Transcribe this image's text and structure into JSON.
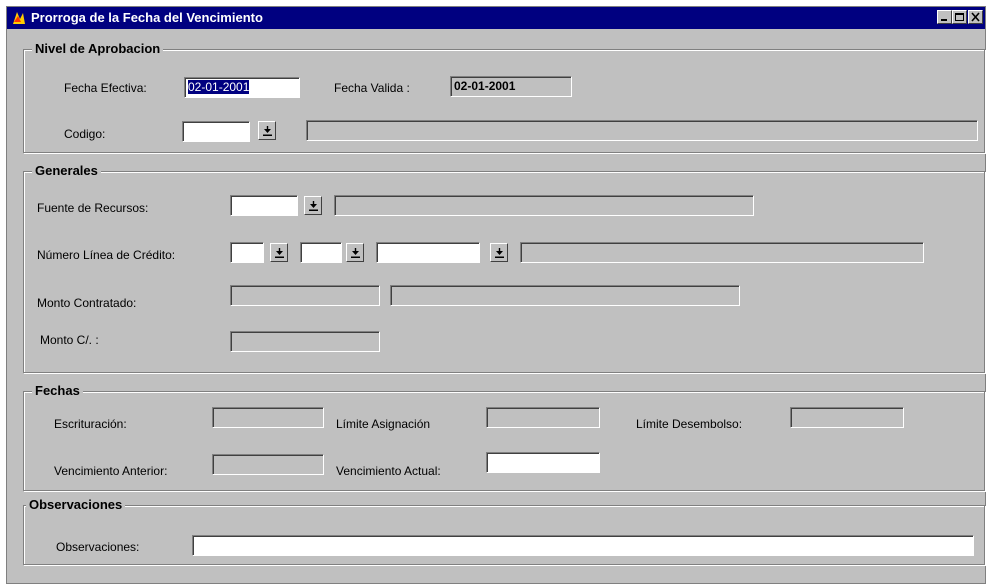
{
  "window": {
    "title": "Prorroga de la Fecha del Vencimiento"
  },
  "nivel": {
    "legend": "Nivel de Aprobacion",
    "fecha_efectiva_label": "Fecha Efectiva:",
    "fecha_efectiva_value": "02-01-2001",
    "fecha_valida_label": "Fecha Valida :",
    "fecha_valida_value": "02-01-2001",
    "codigo_label": "Codigo:",
    "codigo_value": "",
    "codigo_desc": ""
  },
  "generales": {
    "legend": "Generales",
    "fuente_label": "Fuente de Recursos:",
    "fuente_value": "",
    "fuente_desc": "",
    "numero_linea_label": "Número Línea de Crédito:",
    "monto_contratado_label": "Monto Contratado:",
    "monto_c_label": "Monto C/. :"
  },
  "fechas": {
    "legend": "Fechas",
    "escrituracion_label": "Escrituración:",
    "limite_asignacion_label": "Límite Asignación",
    "limite_desembolso_label": "Límite Desembolso:",
    "vencimiento_anterior_label": "Vencimiento Anterior:",
    "vencimiento_actual_label": "Vencimiento Actual:"
  },
  "observaciones": {
    "legend": "Observaciones",
    "label": "Observaciones:",
    "value": ""
  },
  "icons": {
    "dropdown": "dropdown-arrow-icon",
    "minimize": "minimize-icon",
    "maximize": "maximize-icon",
    "close": "close-icon"
  }
}
